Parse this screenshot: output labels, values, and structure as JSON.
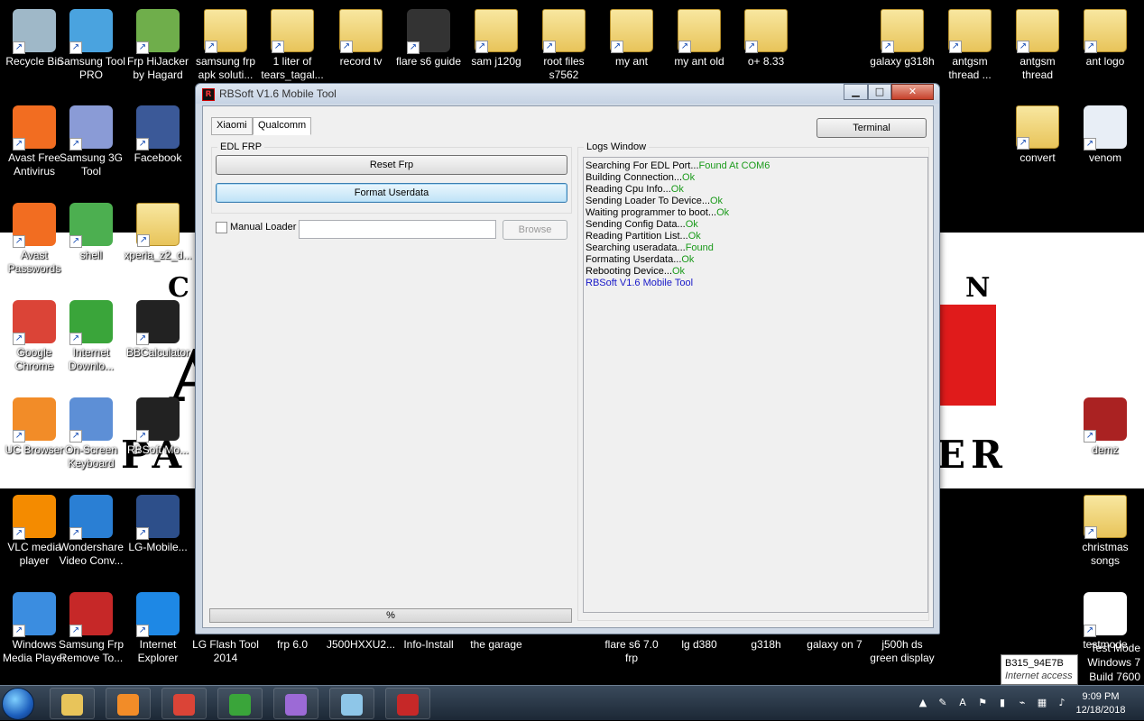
{
  "desktop": {
    "icons": [
      {
        "label": "Recycle Bin",
        "icon": "recycle-bin-icon",
        "color": "#9fb8c8"
      },
      {
        "label": "Samsung Tool PRO",
        "icon": "gear-shield-icon",
        "color": "#4aa3df"
      },
      {
        "label": "Frp HiJacker by Hagard",
        "icon": "frp-hijacker-icon",
        "color": "#6fae4b"
      },
      {
        "label": "samsung frp apk soluti...",
        "icon": "folder-icon",
        "color": "#f0d270"
      },
      {
        "label": "1 liter of tears_tagal...",
        "icon": "folder-icon",
        "color": "#f0d270"
      },
      {
        "label": "record tv",
        "icon": "folder-icon",
        "color": "#f0d270"
      },
      {
        "label": "flare s6 guide",
        "icon": "terminal-icon",
        "color": "#333333"
      },
      {
        "label": "sam j120g",
        "icon": "folder-icon",
        "color": "#f0d270"
      },
      {
        "label": "root files s7562",
        "icon": "folder-icon",
        "color": "#f0d270"
      },
      {
        "label": "my ant",
        "icon": "folder-icon",
        "color": "#f0d270"
      },
      {
        "label": "my ant old",
        "icon": "folder-icon",
        "color": "#f0d270"
      },
      {
        "label": "o+ 8.33",
        "icon": "folder-icon",
        "color": "#f0d270"
      },
      {
        "label": "galaxy g318h",
        "icon": "folder-icon",
        "color": "#f0d270"
      },
      {
        "label": "antgsm thread ...",
        "icon": "folder-icon",
        "color": "#f0d270"
      },
      {
        "label": "antgsm thread",
        "icon": "folder-icon",
        "color": "#f0d270"
      },
      {
        "label": "ant logo",
        "icon": "folder-icon",
        "color": "#f0d270"
      },
      {
        "label": "Avast Free Antivirus",
        "icon": "avast-icon",
        "color": "#f26d21"
      },
      {
        "label": "Samsung 3G Tool",
        "icon": "gear-icon",
        "color": "#8a9bd6"
      },
      {
        "label": "Facebook",
        "icon": "facebook-icon",
        "color": "#3b5998"
      },
      {
        "label": "convert",
        "icon": "folder-icon",
        "color": "#f0d270"
      },
      {
        "label": "venom",
        "icon": "media-file-icon",
        "color": "#e8eef6"
      },
      {
        "label": "Avast Passwords",
        "icon": "key-icon",
        "color": "#f26d21"
      },
      {
        "label": "shell",
        "icon": "play-shield-icon",
        "color": "#4caf50"
      },
      {
        "label": "xperia_z2_d...",
        "icon": "folder-icon",
        "color": "#f0d270"
      },
      {
        "label": "Google Chrome",
        "icon": "chrome-icon",
        "color": "#db4437"
      },
      {
        "label": "Internet Downlo...",
        "icon": "idm-icon",
        "color": "#3aa53a"
      },
      {
        "label": "BBCalculator",
        "icon": "blackberry-icon",
        "color": "#222222"
      },
      {
        "label": "UC Browser",
        "icon": "uc-browser-icon",
        "color": "#f28c28"
      },
      {
        "label": "On-Screen Keyboard",
        "icon": "keyboard-icon",
        "color": "#5d8fd6"
      },
      {
        "label": "RBSoft Mo...",
        "icon": "rbsoft-icon",
        "color": "#222222"
      },
      {
        "label": "demz",
        "icon": "video-file-icon",
        "color": "#aa2222"
      },
      {
        "label": "VLC media player",
        "icon": "vlc-icon",
        "color": "#f48b00"
      },
      {
        "label": "Wondershare Video Conv...",
        "icon": "wondershare-icon",
        "color": "#2a7fd4"
      },
      {
        "label": "LG-Mobile...",
        "icon": "lg-tool-icon",
        "color": "#2d4f8a"
      },
      {
        "label": "christmas songs",
        "icon": "folder-icon",
        "color": "#f0d270"
      },
      {
        "label": "Windows Media Player",
        "icon": "wmp-icon",
        "color": "#3b8de0"
      },
      {
        "label": "Samsung Frp Remove To...",
        "icon": "ntz-icon",
        "color": "#c62828"
      },
      {
        "label": "Internet Explorer",
        "icon": "ie-icon",
        "color": "#1e88e5"
      },
      {
        "label": "LG Flash Tool 2014",
        "icon": "lg-flash-icon",
        "color": "#000000"
      },
      {
        "label": "frp 6.0",
        "icon": "file-icon",
        "color": "#000000"
      },
      {
        "label": "J500HXXU2...",
        "icon": "file-icon",
        "color": "#000000"
      },
      {
        "label": "Info-Install",
        "icon": "file-icon",
        "color": "#000000"
      },
      {
        "label": "the garage",
        "icon": "file-icon",
        "color": "#000000"
      },
      {
        "label": "flare s6 7.0 frp",
        "icon": "file-icon",
        "color": "#000000"
      },
      {
        "label": "lg d380",
        "icon": "file-icon",
        "color": "#000000"
      },
      {
        "label": "g318h",
        "icon": "file-icon",
        "color": "#000000"
      },
      {
        "label": "galaxy on 7",
        "icon": "file-icon",
        "color": "#000000"
      },
      {
        "label": "j500h ds green display",
        "icon": "file-icon",
        "color": "#000000"
      },
      {
        "label": "testmode",
        "icon": "text-file-icon",
        "color": "#ffffff"
      }
    ]
  },
  "window": {
    "title": "RBSoft V1.6 Mobile Tool",
    "app_icon_text": "R",
    "minimize": "▁",
    "maximize": "□",
    "close": "✕",
    "tabs": [
      {
        "label": "Xiaomi",
        "active": false
      },
      {
        "label": "Qualcomm",
        "active": true
      }
    ],
    "terminal_button": "Terminal",
    "edl_group_title": "EDL FRP",
    "reset_frp_button": "Reset Frp",
    "format_userdata_button": "Format Userdata",
    "manual_loader_label": "Manual Loader",
    "manual_loader_checked": false,
    "loader_path_value": "",
    "browse_button": "Browse",
    "progress_text": "%",
    "progress_fraction": 0.0,
    "logs_title": "Logs Window",
    "logs": [
      {
        "text": "Searching For EDL Port...",
        "status": "Found At COM6"
      },
      {
        "text": "Building Connection...",
        "status": "Ok"
      },
      {
        "text": "Reading Cpu Info...",
        "status": "Ok"
      },
      {
        "text": "Sending Loader To Device...",
        "status": "Ok"
      },
      {
        "text": "Waiting programmer to boot...",
        "status": "Ok"
      },
      {
        "text": "Sending Config Data...",
        "status": "Ok"
      },
      {
        "text": "Reading Partition List...",
        "status": "Ok"
      },
      {
        "text": "Searching useradata...",
        "status": "Found"
      },
      {
        "text": "Formating Userdata...",
        "status": "Ok"
      },
      {
        "text": "Rebooting Device...",
        "status": "Ok"
      }
    ],
    "logs_footer": "RBSoft V1.6 Mobile Tool"
  },
  "wallpaper": {
    "letters": [
      "C",
      "A",
      "N",
      "PA",
      "ER"
    ],
    "accent": "#e01b1b"
  },
  "tooltip": {
    "line1": "B315_94E7B",
    "line2": "Internet access"
  },
  "watermark": {
    "line1": "Test Mode",
    "line2": "Windows 7",
    "line3": "Build 7600"
  },
  "taskbar": {
    "pinned": [
      {
        "icon": "explorer-folder-icon",
        "color": "#e8c45a"
      },
      {
        "icon": "uc-browser-icon",
        "color": "#f28c28"
      },
      {
        "icon": "chrome-icon",
        "color": "#db4437"
      },
      {
        "icon": "idm-icon",
        "color": "#3aa53a"
      },
      {
        "icon": "feather-icon",
        "color": "#9c6ad6"
      },
      {
        "icon": "notes-icon",
        "color": "#8ec6e8"
      },
      {
        "icon": "rbsoft-icon",
        "color": "#c62828"
      }
    ],
    "tray_icons": [
      "show-hidden-icon",
      "pen-icon",
      "avast-tray-icon",
      "flag-icon",
      "signal-icon",
      "usb-icon",
      "network-icon",
      "volume-icon"
    ],
    "time": "9:09 PM",
    "date": "12/18/2018"
  }
}
